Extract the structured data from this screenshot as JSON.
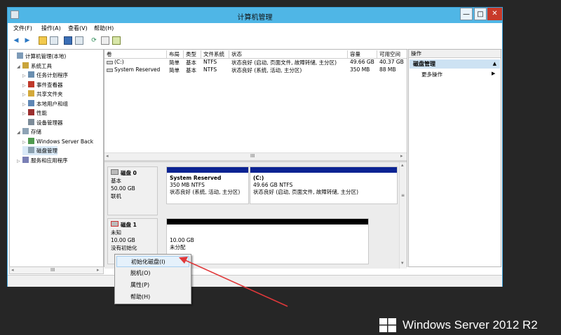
{
  "window": {
    "title": "计算机管理"
  },
  "window_buttons": {
    "minimize": "—",
    "maximize": "□",
    "close": "✕"
  },
  "menu": [
    "文件(F)",
    "操作(A)",
    "查看(V)",
    "帮助(H)"
  ],
  "tree": [
    {
      "label": "计算机管理(本地)",
      "indent": 0,
      "expand": "",
      "icon": "computer-icon"
    },
    {
      "label": "系统工具",
      "indent": 1,
      "expand": "◢",
      "icon": "tools-icon"
    },
    {
      "label": "任务计划程序",
      "indent": 2,
      "expand": "▷",
      "icon": "clock-icon"
    },
    {
      "label": "事件查看器",
      "indent": 2,
      "expand": "▷",
      "icon": "event-viewer-icon"
    },
    {
      "label": "共享文件夹",
      "indent": 2,
      "expand": "▷",
      "icon": "shared-folder-icon"
    },
    {
      "label": "本地用户和组",
      "indent": 2,
      "expand": "▷",
      "icon": "users-icon"
    },
    {
      "label": "性能",
      "indent": 2,
      "expand": "▷",
      "icon": "performance-icon"
    },
    {
      "label": "设备管理器",
      "indent": 2,
      "expand": "",
      "icon": "device-manager-icon"
    },
    {
      "label": "存储",
      "indent": 1,
      "expand": "◢",
      "icon": "storage-icon"
    },
    {
      "label": "Windows Server Back",
      "indent": 2,
      "expand": "▷",
      "icon": "backup-icon"
    },
    {
      "label": "磁盘管理",
      "indent": 2,
      "expand": "",
      "icon": "disk-management-icon"
    },
    {
      "label": "服务和应用程序",
      "indent": 1,
      "expand": "▷",
      "icon": "services-icon"
    }
  ],
  "volumes": {
    "headers": [
      "卷",
      "布局",
      "类型",
      "文件系统",
      "状态",
      "容量",
      "可用空间"
    ],
    "rows": [
      [
        "(C:)",
        "简单",
        "基本",
        "NTFS",
        "状态良好 (启动, 页面文件, 故障转储, 主分区)",
        "49.66 GB",
        "40.37 GB"
      ],
      [
        "System Reserved",
        "简单",
        "基本",
        "NTFS",
        "状态良好 (系统, 活动, 主分区)",
        "350 MB",
        "88 MB"
      ]
    ]
  },
  "disk0": {
    "name": "磁盘 0",
    "type": "基本",
    "size": "50.00 GB",
    "status": "联机",
    "partitions": [
      {
        "name": "System Reserved",
        "size": "350 MB NTFS",
        "status": "状态良好 (系统, 活动, 主分区)"
      },
      {
        "name": "(C:)",
        "size": "49.66 GB NTFS",
        "status": "状态良好 (启动, 页面文件, 故障转储, 主分区)"
      }
    ]
  },
  "disk1": {
    "name": "磁盘 1",
    "type": "未知",
    "size": "10.00 GB",
    "status": "没有初始化",
    "space_size": "10.00 GB",
    "space_label": "未分配"
  },
  "context_menu": [
    "初始化磁盘(I)",
    "脱机(O)",
    "属性(P)",
    "帮助(H)"
  ],
  "actions": {
    "header": "操作",
    "section": "磁盘管理",
    "more": "更多操作"
  },
  "scroll": {
    "mark": "III"
  },
  "brand": "Windows Server 2012 R2",
  "colors": {
    "partition_bar": "#0b2392",
    "unallocated_bar": "#000000",
    "annotation_arrow": "#e0383a"
  }
}
